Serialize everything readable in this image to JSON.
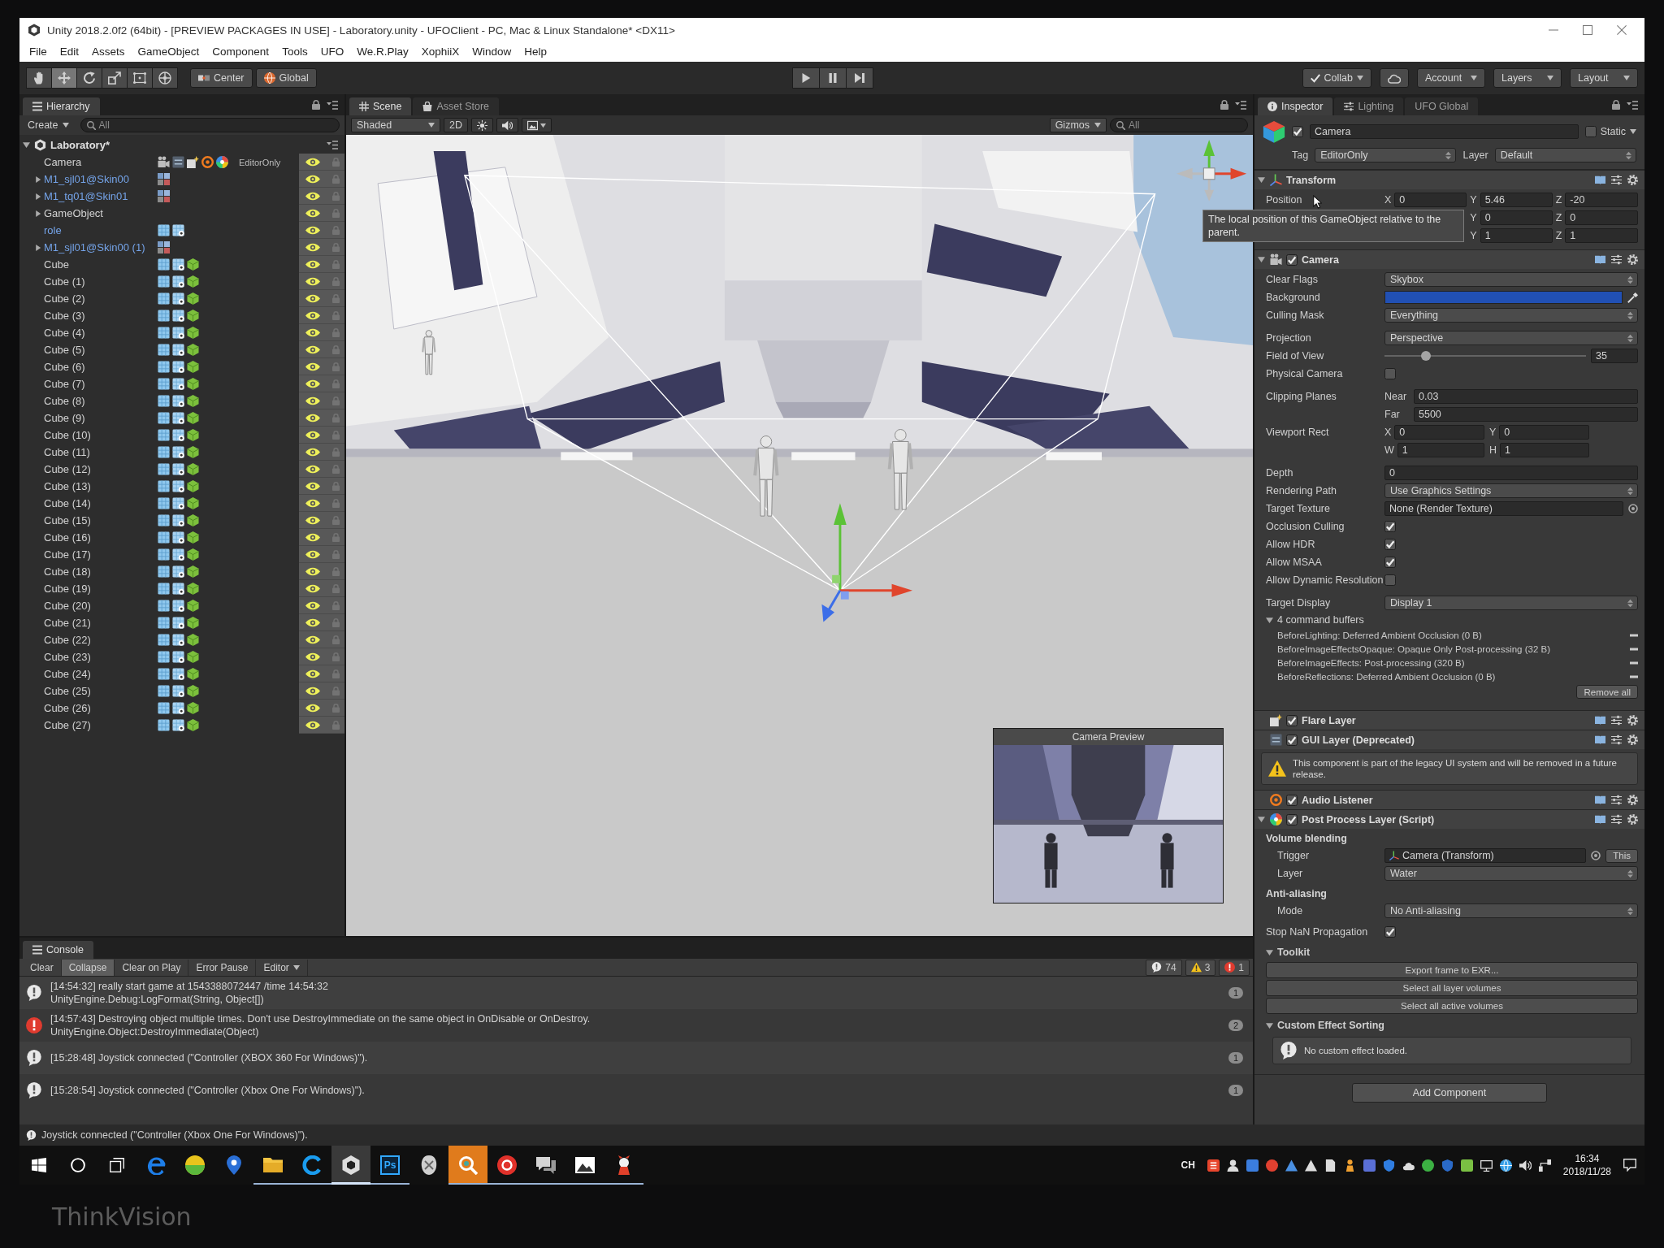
{
  "monitor": {
    "brand": "ThinkVision"
  },
  "window": {
    "title": "Unity 2018.2.0f2 (64bit) - [PREVIEW PACKAGES IN USE] - Laboratory.unity - UFOClient - PC, Mac & Linux Standalone* <DX11>"
  },
  "menu": [
    "File",
    "Edit",
    "Assets",
    "GameObject",
    "Component",
    "Tools",
    "UFO",
    "We.R.Play",
    "XophiiX",
    "Window",
    "Help"
  ],
  "toolbar": {
    "tools": [
      {
        "kind": "hand",
        "selected": false
      },
      {
        "kind": "move",
        "selected": true
      },
      {
        "kind": "rotate",
        "selected": false
      },
      {
        "kind": "scale",
        "selected": false
      },
      {
        "kind": "rect",
        "selected": false
      },
      {
        "kind": "transform",
        "selected": false
      }
    ],
    "pivot": [
      {
        "kind": "center",
        "label": "Center"
      },
      {
        "kind": "global",
        "label": "Global"
      }
    ],
    "playback": [
      {
        "kind": "play"
      },
      {
        "kind": "pause"
      },
      {
        "kind": "step"
      }
    ],
    "services": [
      {
        "kind": "collab",
        "label": "Collab"
      },
      {
        "kind": "cloud"
      },
      {
        "kind": "dropdown",
        "label": "Account"
      },
      {
        "kind": "dropdown",
        "label": "Layers"
      },
      {
        "kind": "dropdown",
        "label": "Layout"
      }
    ]
  },
  "hierarchy": {
    "tab": "Hierarchy",
    "create": "Create",
    "search_placeholder": "All",
    "root": {
      "name": "Laboratory*",
      "expanded": true,
      "children": [
        {
          "name": "Camera",
          "kind": "camera",
          "prefab": false,
          "collapsed": false,
          "selected": false,
          "visible": true,
          "tag": "EditorOnly"
        },
        {
          "name": "M1_sjl01@Skin00",
          "kind": "model",
          "prefab": true,
          "collapsed": true,
          "selected": false,
          "visible": true
        },
        {
          "name": "M1_tq01@Skin01",
          "kind": "model",
          "prefab": true,
          "collapsed": true,
          "selected": false,
          "visible": true
        },
        {
          "name": "GameObject",
          "kind": "empty",
          "prefab": false,
          "collapsed": true,
          "selected": false,
          "visible": true
        },
        {
          "name": "role",
          "kind": "mesh",
          "prefab": true,
          "collapsed": false,
          "selected": false,
          "visible": true
        },
        {
          "name": "M1_sjl01@Skin00 (1)",
          "kind": "model",
          "prefab": true,
          "collapsed": true,
          "selected": false,
          "visible": true
        },
        {
          "name": "Cube",
          "kind": "cube",
          "prefab": false,
          "collapsed": false,
          "selected": false,
          "visible": true
        },
        {
          "name": "Cube (1)",
          "kind": "cube",
          "prefab": false,
          "collapsed": false,
          "selected": false,
          "visible": true
        },
        {
          "name": "Cube (2)",
          "kind": "cube",
          "prefab": false,
          "collapsed": false,
          "selected": false,
          "visible": true
        },
        {
          "name": "Cube (3)",
          "kind": "cube",
          "prefab": false,
          "collapsed": false,
          "selected": false,
          "visible": true
        },
        {
          "name": "Cube (4)",
          "kind": "cube",
          "prefab": false,
          "collapsed": false,
          "selected": false,
          "visible": true
        },
        {
          "name": "Cube (5)",
          "kind": "cube",
          "prefab": false,
          "collapsed": false,
          "selected": false,
          "visible": true
        },
        {
          "name": "Cube (6)",
          "kind": "cube",
          "prefab": false,
          "collapsed": false,
          "selected": false,
          "visible": true
        },
        {
          "name": "Cube (7)",
          "kind": "cube",
          "prefab": false,
          "collapsed": false,
          "selected": false,
          "visible": true
        },
        {
          "name": "Cube (8)",
          "kind": "cube",
          "prefab": false,
          "collapsed": false,
          "selected": false,
          "visible": true
        },
        {
          "name": "Cube (9)",
          "kind": "cube",
          "prefab": false,
          "collapsed": false,
          "selected": false,
          "visible": true
        },
        {
          "name": "Cube (10)",
          "kind": "cube",
          "prefab": false,
          "collapsed": false,
          "selected": false,
          "visible": true
        },
        {
          "name": "Cube (11)",
          "kind": "cube",
          "prefab": false,
          "collapsed": false,
          "selected": false,
          "visible": true
        },
        {
          "name": "Cube (12)",
          "kind": "cube",
          "prefab": false,
          "collapsed": false,
          "selected": false,
          "visible": true
        },
        {
          "name": "Cube (13)",
          "kind": "cube",
          "prefab": false,
          "collapsed": false,
          "selected": false,
          "visible": true
        },
        {
          "name": "Cube (14)",
          "kind": "cube",
          "prefab": false,
          "collapsed": false,
          "selected": false,
          "visible": true
        },
        {
          "name": "Cube (15)",
          "kind": "cube",
          "prefab": false,
          "collapsed": false,
          "selected": false,
          "visible": true
        },
        {
          "name": "Cube (16)",
          "kind": "cube",
          "prefab": false,
          "collapsed": false,
          "selected": false,
          "visible": true
        },
        {
          "name": "Cube (17)",
          "kind": "cube",
          "prefab": false,
          "collapsed": false,
          "selected": false,
          "visible": true
        },
        {
          "name": "Cube (18)",
          "kind": "cube",
          "prefab": false,
          "collapsed": false,
          "selected": false,
          "visible": true
        },
        {
          "name": "Cube (19)",
          "kind": "cube",
          "prefab": false,
          "collapsed": false,
          "selected": false,
          "visible": true
        },
        {
          "name": "Cube (20)",
          "kind": "cube",
          "prefab": false,
          "collapsed": false,
          "selected": false,
          "visible": true
        },
        {
          "name": "Cube (21)",
          "kind": "cube",
          "prefab": false,
          "collapsed": false,
          "selected": false,
          "visible": true
        },
        {
          "name": "Cube (22)",
          "kind": "cube",
          "prefab": false,
          "collapsed": false,
          "selected": false,
          "visible": true
        },
        {
          "name": "Cube (23)",
          "kind": "cube",
          "prefab": false,
          "collapsed": false,
          "selected": false,
          "visible": true
        },
        {
          "name": "Cube (24)",
          "kind": "cube",
          "prefab": false,
          "collapsed": false,
          "selected": false,
          "visible": true
        },
        {
          "name": "Cube (25)",
          "kind": "cube",
          "prefab": false,
          "collapsed": false,
          "selected": false,
          "visible": true
        },
        {
          "name": "Cube (26)",
          "kind": "cube",
          "prefab": false,
          "collapsed": false,
          "selected": false,
          "visible": true
        },
        {
          "name": "Cube (27)",
          "kind": "cube",
          "prefab": false,
          "collapsed": false,
          "selected": false,
          "visible": true
        }
      ]
    }
  },
  "scene": {
    "tabs": [
      {
        "label": "Scene",
        "kind": "scene",
        "selected": true
      },
      {
        "label": "Asset Store",
        "kind": "store",
        "selected": false
      }
    ],
    "shading": "Shaded",
    "toggles": [
      {
        "kind": "mode2d",
        "label": "2D",
        "on": false
      },
      {
        "kind": "lighting",
        "on": false
      },
      {
        "kind": "audio",
        "on": false
      },
      {
        "kind": "effects",
        "on": false
      }
    ],
    "gizmos": "Gizmos",
    "search_placeholder": "All",
    "preview_title": "Camera Preview"
  },
  "console": {
    "tab": "Console",
    "buttons": [
      {
        "label": "Clear",
        "on": false
      },
      {
        "label": "Collapse",
        "on": true
      },
      {
        "label": "Clear on Play",
        "on": false
      },
      {
        "label": "Error Pause",
        "on": false
      }
    ],
    "source": "Editor",
    "counts": [
      {
        "kind": "info",
        "count": "74"
      },
      {
        "kind": "warning",
        "count": "3"
      },
      {
        "kind": "error",
        "count": "1"
      }
    ],
    "entries": [
      {
        "kind": "info",
        "text": "[14:54:32] really start game at 1543388072447 /time 14:54:32",
        "trace": "UnityEngine.Debug:LogFormat(String, Object[])",
        "count": "1"
      },
      {
        "kind": "error",
        "text": "[14:57:43] Destroying object multiple times. Don't use DestroyImmediate on the same object in OnDisable or OnDestroy.",
        "trace": "UnityEngine.Object:DestroyImmediate(Object)",
        "count": "2"
      },
      {
        "kind": "info",
        "text": "[15:28:48] Joystick connected (\"Controller (XBOX 360 For Windows)\").",
        "count": "1"
      },
      {
        "kind": "info",
        "text": "[15:28:54] Joystick connected (\"Controller (Xbox One For Windows)\").",
        "count": "1"
      }
    ]
  },
  "inspector": {
    "tabs": [
      {
        "label": "Inspector",
        "kind": "info",
        "selected": true
      },
      {
        "label": "Lighting",
        "kind": "lighting",
        "selected": false
      },
      {
        "label": "UFO Global",
        "kind": "plain",
        "selected": false
      }
    ],
    "object": {
      "active": true,
      "name": "Camera",
      "static_label": "Static",
      "static": false,
      "tag_label": "Tag",
      "tag": "EditorOnly",
      "layer_label": "Layer",
      "layer": "Default"
    },
    "tooltip": "The local position of this GameObject relative to the parent.",
    "components": [
      {
        "kind": "transform",
        "title": "Transform",
        "expanded": true,
        "rows": [
          {
            "label": "Position",
            "fields": [
              {
                "axis": "X",
                "value": "0"
              },
              {
                "axis": "Y",
                "value": "5.46"
              },
              {
                "axis": "Z",
                "value": "-20"
              }
            ]
          },
          {
            "fields": [
              {
                "axis": "Y",
                "value": "0"
              },
              {
                "axis": "Z",
                "value": "0"
              }
            ]
          },
          {
            "fields": [
              {
                "axis": "Y",
                "value": "1"
              },
              {
                "axis": "Z",
                "value": "1"
              }
            ]
          }
        ]
      },
      {
        "kind": "camera",
        "title": "Camera",
        "enabled": true,
        "expanded": true,
        "groups": [
          [
            {
              "kind": "dropdown",
              "label": "Clear Flags",
              "value": "Skybox"
            },
            {
              "kind": "color",
              "label": "Background",
              "color": "#2150b4"
            },
            {
              "kind": "dropdown",
              "label": "Culling Mask",
              "value": "Everything"
            }
          ],
          [
            {
              "kind": "dropdown",
              "label": "Projection",
              "value": "Perspective"
            },
            {
              "kind": "slider",
              "label": "Field of View",
              "level": 0.19,
              "reading": "35"
            },
            {
              "kind": "checkbox",
              "label": "Physical Camera",
              "checked": false
            }
          ],
          [
            {
              "kind": "pair",
              "label": "Clipping Planes",
              "fields": [
                {
                  "axis": "Near",
                  "value": "0.03"
                },
                {
                  "axis": "Far",
                  "value": "5500"
                }
              ]
            },
            {
              "kind": "rect",
              "label": "Viewport Rect",
              "fields": [
                {
                  "axis": "X",
                  "value": "0"
                },
                {
                  "axis": "Y",
                  "value": "0"
                },
                {
                  "axis": "W",
                  "value": "1"
                },
                {
                  "axis": "H",
                  "value": "1"
                }
              ]
            }
          ],
          [
            {
              "kind": "field",
              "label": "Depth",
              "value": "0"
            },
            {
              "kind": "dropdown",
              "label": "Rendering Path",
              "value": "Use Graphics Settings"
            },
            {
              "kind": "object",
              "label": "Target Texture",
              "value": "None (Render Texture)"
            },
            {
              "kind": "checkbox",
              "label": "Occlusion Culling",
              "checked": true
            },
            {
              "kind": "checkbox",
              "label": "Allow HDR",
              "checked": true
            },
            {
              "kind": "checkbox",
              "label": "Allow MSAA",
              "checked": true
            },
            {
              "kind": "checkbox",
              "label": "Allow Dynamic Resolution",
              "checked": false
            }
          ],
          [
            {
              "kind": "dropdown",
              "label": "Target Display",
              "value": "Display 1"
            },
            {
              "kind": "buffers",
              "label": "4 command buffers",
              "expanded": true,
              "items": [
                "BeforeLighting: Deferred Ambient Occlusion (0 B)",
                "BeforeImageEffectsOpaque: Opaque Only Post-processing (32 B)",
                "BeforeImageEffects: Post-processing (320 B)",
                "BeforeReflections: Deferred Ambient Occlusion (0 B)"
              ],
              "button": "Remove all"
            }
          ]
        ]
      },
      {
        "kind": "flare",
        "title": "Flare Layer",
        "enabled": true,
        "expanded": false
      },
      {
        "kind": "gui",
        "title": "GUI Layer (Deprecated)",
        "enabled": true,
        "expanded": false,
        "warning": "This component is part of the legacy UI system and will be removed in a future release."
      },
      {
        "kind": "audio",
        "title": "Audio Listener",
        "enabled": true,
        "expanded": false
      },
      {
        "kind": "script",
        "title": "Post Process Layer (Script)",
        "enabled": true,
        "expanded": true,
        "sections": [
          {
            "kind": "group",
            "heading": "Volume blending",
            "properties": [
              {
                "kind": "reference",
                "label": "Trigger",
                "value": "Camera (Transform)",
                "button": "This"
              },
              {
                "kind": "dropdown",
                "label": "Layer",
                "value": "Water"
              }
            ]
          },
          {
            "kind": "group",
            "heading": "Anti-aliasing",
            "properties": [
              {
                "kind": "dropdown",
                "label": "Mode",
                "value": "No Anti-aliasing"
              }
            ]
          },
          {
            "kind": "group",
            "properties": [
              {
                "kind": "checkbox",
                "label": "Stop NaN Propagation",
                "checked": true
              }
            ]
          },
          {
            "kind": "foldout",
            "heading": "Toolkit",
            "expanded": true,
            "buttons": [
              "Export frame to EXR...",
              "Select all layer volumes",
              "Select all active volumes"
            ]
          },
          {
            "kind": "foldout",
            "heading": "Custom Effect Sorting",
            "expanded": true,
            "info": "No custom effect loaded."
          }
        ]
      }
    ],
    "add_component": "Add Component"
  },
  "status": {
    "kind": "info",
    "text": "Joystick connected (\"Controller (Xbox One For Windows)\")."
  },
  "taskbar": {
    "apps": [
      {
        "kind": "browser-e",
        "open": false,
        "selected": false,
        "flashing": false
      },
      {
        "kind": "ball",
        "open": false,
        "selected": false,
        "flashing": false
      },
      {
        "kind": "pin",
        "open": false,
        "selected": false,
        "flashing": false
      },
      {
        "kind": "folder",
        "open": true,
        "selected": false,
        "flashing": false
      },
      {
        "kind": "browser-c",
        "open": true,
        "selected": false,
        "flashing": false
      },
      {
        "kind": "editor",
        "open": true,
        "selected": true,
        "flashing": false
      },
      {
        "kind": "text",
        "text": "Ps",
        "open": true,
        "selected": false,
        "flashing": false
      },
      {
        "kind": "shell",
        "open": false,
        "selected": false,
        "flashing": false
      },
      {
        "kind": "search",
        "open": true,
        "selected": false,
        "flashing": true
      },
      {
        "kind": "music",
        "open": true,
        "selected": false,
        "flashing": false
      },
      {
        "kind": "chat",
        "open": true,
        "selected": false,
        "flashing": false
      },
      {
        "kind": "picture",
        "open": true,
        "selected": false,
        "flashing": false
      },
      {
        "kind": "mascot",
        "open": true,
        "selected": false,
        "flashing": false
      }
    ],
    "tray": {
      "language": "CH",
      "icons": [
        {
          "kind": "ime"
        },
        {
          "kind": "person"
        },
        {
          "kind": "tile",
          "color": "#3b7ddd"
        },
        {
          "kind": "disc",
          "color": "#e04030"
        },
        {
          "kind": "triangle",
          "color": "#4a90e2"
        },
        {
          "kind": "triangle",
          "color": "#dddddd"
        },
        {
          "kind": "document"
        },
        {
          "kind": "figure"
        },
        {
          "kind": "tile",
          "color": "#5a6fd6"
        },
        {
          "kind": "shield",
          "color": "#2f7de0"
        },
        {
          "kind": "cloud"
        },
        {
          "kind": "disc",
          "color": "#3cb043"
        },
        {
          "kind": "shield",
          "color": "#2a6ac8"
        },
        {
          "kind": "tile",
          "color": "#7ac043"
        },
        {
          "kind": "monitor"
        },
        {
          "kind": "globe"
        },
        {
          "kind": "speaker"
        },
        {
          "kind": "network"
        }
      ],
      "time": "16:34",
      "date": "2018/11/28"
    }
  }
}
